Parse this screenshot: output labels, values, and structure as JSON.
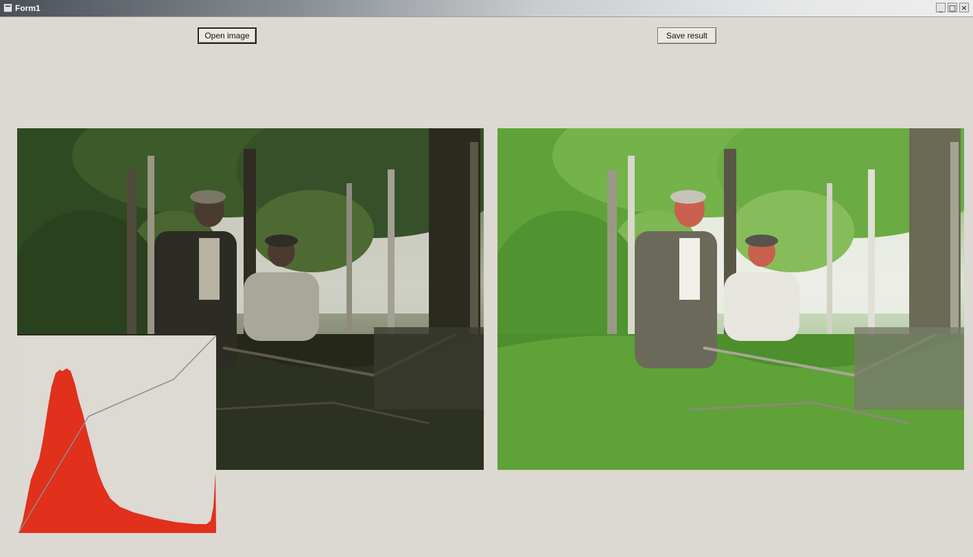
{
  "window": {
    "title": "Form1",
    "controls": {
      "minimize": "_",
      "maximize": "□",
      "close": "×"
    }
  },
  "toolbar": {
    "open_label": "Open image",
    "save_label": "Save result"
  },
  "images": {
    "original": "forest photo with two people (original, dark)",
    "result": "forest photo with two people (enhanced, brighter)"
  },
  "histogram": {
    "fill_color": "#e1301c",
    "curve_color": "#8a8f96"
  }
}
